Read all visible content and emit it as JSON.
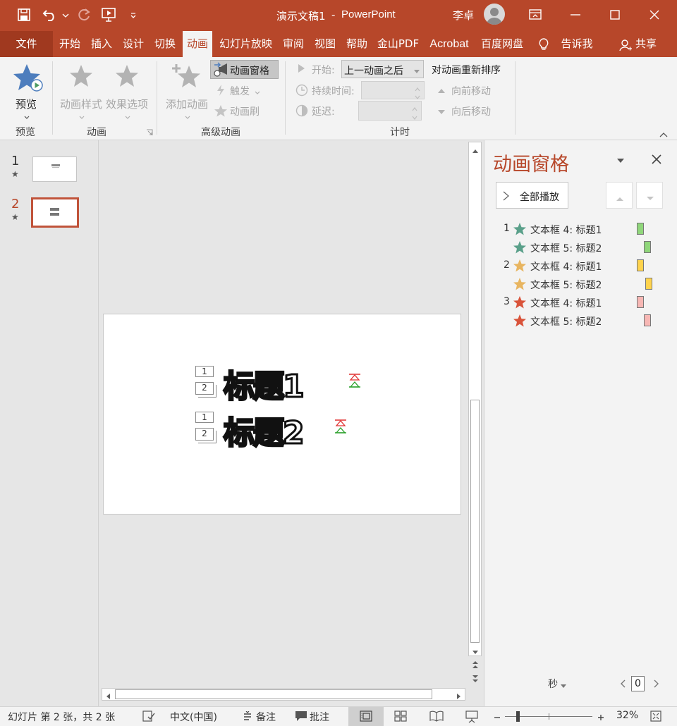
{
  "titlebar": {
    "doc_title": "演示文稿1",
    "separator": "-",
    "app_name": "PowerPoint",
    "user_name": "李卓"
  },
  "tabs": {
    "file": "文件",
    "home": "开始",
    "insert": "插入",
    "design": "设计",
    "transitions": "切换",
    "animations": "动画",
    "slideshow": "幻灯片放映",
    "review": "审阅",
    "view": "视图",
    "help": "帮助",
    "kingsoft_pdf": "金山PDF",
    "acrobat": "Acrobat",
    "baidu": "百度网盘",
    "tell_me": "告诉我",
    "share": "共享"
  },
  "ribbon": {
    "preview_btn": "预览",
    "preview_group": "预览",
    "anim_styles_btn": "动画样式",
    "effect_options_btn": "效果选项",
    "animation_group": "动画",
    "add_anim_btn": "添加动画",
    "anim_pane_btn": "动画窗格",
    "trigger_btn": "触发",
    "anim_painter_btn": "动画刷",
    "advanced_group": "高级动画",
    "start_label": "开始:",
    "start_value": "上一动画之后",
    "duration_label": "持续时间:",
    "delay_label": "延迟:",
    "timing_group": "计时",
    "reorder_title": "对动画重新排序",
    "move_earlier": "向前移动",
    "move_later": "向后移动"
  },
  "thumbnails": [
    {
      "number": "1",
      "star": "★"
    },
    {
      "number": "2",
      "star": "★"
    }
  ],
  "slide": {
    "title1": "标题1",
    "title2": "标题2",
    "tag_1": "1",
    "tag_2": "2"
  },
  "pane": {
    "title": "动画窗格",
    "play_all": "全部播放",
    "rows": [
      {
        "index": "1",
        "label": "文本框 4: 标题1",
        "star_color": "#5aa08a",
        "bar_color": "#8fd67a"
      },
      {
        "index": "",
        "label": "文本框 5: 标题2",
        "star_color": "#5aa08a",
        "bar_color": "#8fd67a"
      },
      {
        "index": "2",
        "label": "文本框 4: 标题1",
        "star_color": "#e8b560",
        "bar_color": "#ffd34d"
      },
      {
        "index": "",
        "label": "文本框 5: 标题2",
        "star_color": "#e8b560",
        "bar_color": "#ffd34d"
      },
      {
        "index": "3",
        "label": "文本框 4: 标题1",
        "star_color": "#d9533a",
        "bar_color": "#f7b7b4"
      },
      {
        "index": "",
        "label": "文本框 5: 标题2",
        "star_color": "#d9533a",
        "bar_color": "#f7b7b4"
      }
    ],
    "seconds_label": "秒",
    "timeline_value": "0"
  },
  "status": {
    "slide_info": "幻灯片 第 2 张，共 2 张",
    "language": "中文(中国)",
    "notes": "备注",
    "comments": "批注",
    "zoom": "32%"
  },
  "colors": {
    "accent": "#b7472a",
    "ribbon_bg": "#f3f3f3"
  }
}
